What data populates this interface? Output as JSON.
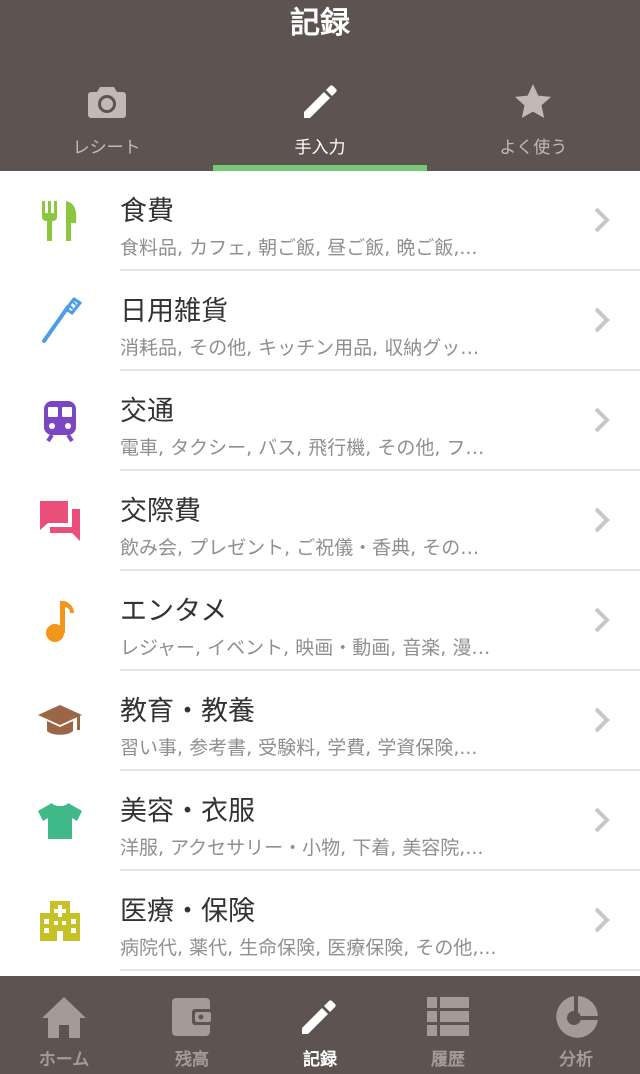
{
  "header": {
    "title": "記録",
    "tabs": [
      {
        "label": "レシート",
        "icon": "camera-icon"
      },
      {
        "label": "手入力",
        "icon": "pencil-icon",
        "active": true
      },
      {
        "label": "よく使う",
        "icon": "star-icon"
      }
    ]
  },
  "categories": [
    {
      "title": "食費",
      "sub": "食料品, カフェ, 朝ご飯, 昼ご飯, 晩ご飯,...",
      "icon": "fork-knife-icon",
      "color": "#8cc63f"
    },
    {
      "title": "日用雑貨",
      "sub": "消耗品, その他, キッチン用品, 収納グッ…",
      "icon": "toothbrush-icon",
      "color": "#4a9de6"
    },
    {
      "title": "交通",
      "sub": "電車, タクシー, バス, 飛行機, その他, フ…",
      "icon": "train-icon",
      "color": "#7b46c2"
    },
    {
      "title": "交際費",
      "sub": "飲み会, プレゼント, ご祝儀・香典, その…",
      "icon": "chat-bubbles-icon",
      "color": "#ea4f7b"
    },
    {
      "title": "エンタメ",
      "sub": "レジャー, イベント, 映画・動画, 音楽, 漫…",
      "icon": "music-note-icon",
      "color": "#f3951b"
    },
    {
      "title": "教育・教養",
      "sub": "習い事, 参考書, 受験料, 学費, 学資保険,...",
      "icon": "graduation-cap-icon",
      "color": "#9a6645"
    },
    {
      "title": "美容・衣服",
      "sub": "洋服, アクセサリー・小物, 下着, 美容院,...",
      "icon": "tshirt-icon",
      "color": "#3fb988"
    },
    {
      "title": "医療・保険",
      "sub": "病院代, 薬代, 生命保険, 医療保険, その他,...",
      "icon": "hospital-icon",
      "color": "#c7c128"
    }
  ],
  "bottom_nav": [
    {
      "label": "ホーム",
      "icon": "home-icon"
    },
    {
      "label": "残高",
      "icon": "wallet-icon"
    },
    {
      "label": "記録",
      "icon": "pencil-icon",
      "active": true
    },
    {
      "label": "履歴",
      "icon": "list-icon"
    },
    {
      "label": "分析",
      "icon": "pie-chart-icon"
    }
  ],
  "colors": {
    "header_bg": "#5d5351",
    "tab_indicator": "#79c879",
    "inactive_text": "#c2b9b6"
  }
}
